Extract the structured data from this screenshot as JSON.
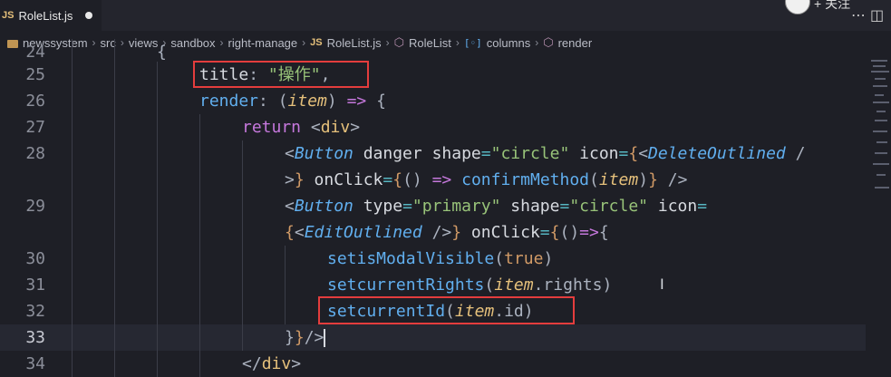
{
  "tab": {
    "icon": "JS",
    "filename": "RoleList.js"
  },
  "overlay": {
    "text": "+ 关注"
  },
  "toolbar": {
    "split_icon": "split-editor-icon"
  },
  "breadcrumb": {
    "items": [
      "newssystem",
      "src",
      "views",
      "sandbox",
      "right-manage",
      "RoleList.js",
      "RoleList",
      "columns",
      "render"
    ]
  },
  "editor": {
    "lines": [
      {
        "n": "24",
        "text": "{"
      },
      {
        "n": "25",
        "text": "title: \"操作\","
      },
      {
        "n": "26",
        "text": "render: (item) => {"
      },
      {
        "n": "27",
        "text": "return <div>"
      },
      {
        "n": "28",
        "text": "<Button danger shape=\"circle\" icon={<DeleteOutlined />} onClick={() => confirmMethod(item)} />"
      },
      {
        "n": "29",
        "text": "<Button type=\"primary\" shape=\"circle\" icon={<EditOutlined />} onClick={()=>{"
      },
      {
        "n": "30",
        "text": "setisModalVisible(true)"
      },
      {
        "n": "31",
        "text": "setcurrentRights(item.rights)"
      },
      {
        "n": "32",
        "text": "setcurrentId(item.id)"
      },
      {
        "n": "33",
        "text": "}}/>"
      },
      {
        "n": "34",
        "text": "</div>"
      }
    ],
    "highlighted": [
      "title: \"操作\",",
      "setcurrentId(item.id)"
    ]
  }
}
